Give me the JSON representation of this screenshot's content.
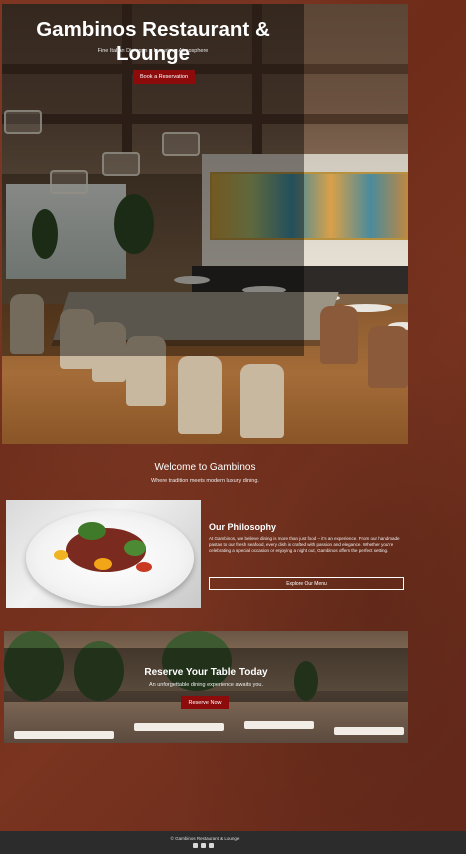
{
  "hero": {
    "title": "Gambinos Restaurant & Lounge",
    "subtitle": "Fine Italian Dining in a Luxurious Atmosphere",
    "cta_label": "Book a Reservation"
  },
  "welcome": {
    "title": "Welcome to Gambinos",
    "subtitle": "Where tradition meets modern luxury dining."
  },
  "philosophy": {
    "title": "Our Philosophy",
    "text": "At Gambinos, we believe dining is more than just food – it's an experience. From our handmade pastas to our fresh seafood, every dish is crafted with passion and elegance. Whether you're celebrating a special occasion or enjoying a night out, Gambinos offers the perfect setting.",
    "button_label": "Explore Our Menu"
  },
  "reserve": {
    "title": "Reserve Your Table Today",
    "subtitle": "An unforgettable dining experience awaits you.",
    "button_label": "Reserve Now"
  },
  "footer": {
    "copyright": "© Gambinos Restaurant & Lounge",
    "social_icons": [
      "facebook-icon",
      "instagram-icon",
      "twitter-icon"
    ]
  },
  "colors": {
    "accent": "#8e0b0b",
    "background": "#7a3420",
    "footer": "#2c2c2c"
  }
}
